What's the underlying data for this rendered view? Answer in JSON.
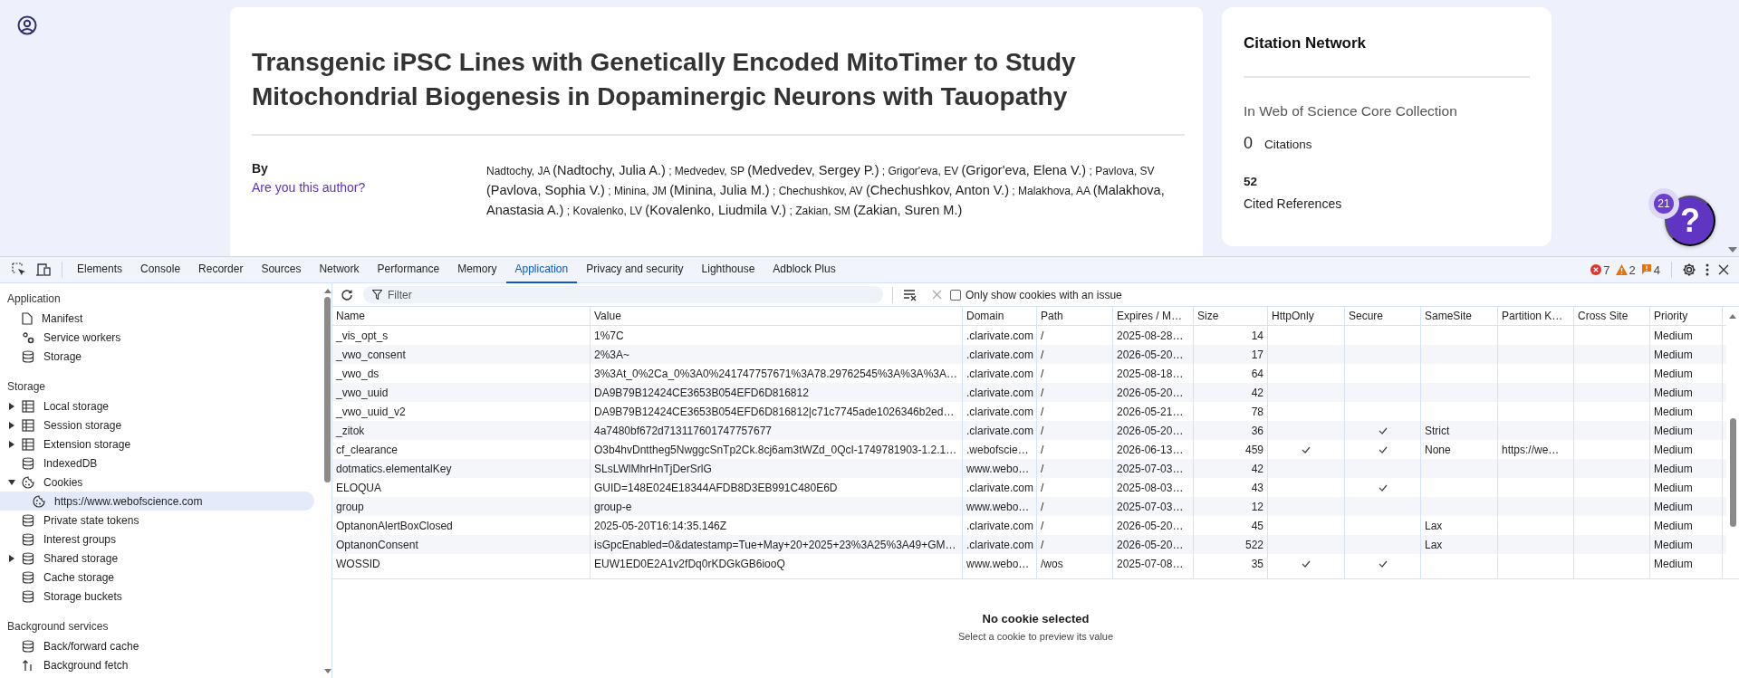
{
  "article": {
    "title": "Transgenic iPSC Lines with Genetically Encoded MitoTimer to Study Mitochondrial Biogenesis in Dopaminergic Neurons with Tauopathy",
    "by_label": "By",
    "author_link": "Are you this author?",
    "authors": [
      {
        "short": "Nadtochy, JA",
        "full": "(Nadtochy, Julia A.)",
        "sep": ";"
      },
      {
        "short": "Medvedev, SP",
        "full": "(Medvedev, Sergey P.)",
        "sep": ";"
      },
      {
        "short": "Grigor'eva, EV",
        "full": "(Grigor'eva, Elena V.)",
        "sep": ";"
      },
      {
        "short": "Pavlova, SV",
        "full": "(Pavlova, Sophia V.)",
        "sep": ";"
      },
      {
        "short": "Minina, JM",
        "full": "(Minina, Julia M.)",
        "sep": ";"
      },
      {
        "short": "Chechushkov, AV",
        "full": "(Chechushkov, Anton V.)",
        "sep": ";"
      },
      {
        "short": "Malakhova, AA",
        "full": "(Malakhova, Anastasia A.)",
        "sep": ";"
      },
      {
        "short": "Kovalenko, LV",
        "full": "(Kovalenko, Liudmila V.)",
        "sep": ";"
      },
      {
        "short": "Zakian, SM",
        "full": "(Zakian, Suren M.)"
      }
    ]
  },
  "citation": {
    "title": "Citation Network",
    "collection": "In Web of Science Core Collection",
    "citations_count": "0",
    "citations_label": "Citations",
    "references_count": "52",
    "references_label": "Cited References"
  },
  "help": {
    "badge": "21",
    "label": "?"
  },
  "devtools": {
    "tabs": [
      {
        "label": "Elements",
        "selected": false
      },
      {
        "label": "Console",
        "selected": false
      },
      {
        "label": "Recorder",
        "selected": false
      },
      {
        "label": "Sources",
        "selected": false
      },
      {
        "label": "Network",
        "selected": false
      },
      {
        "label": "Performance",
        "selected": false
      },
      {
        "label": "Memory",
        "selected": false
      },
      {
        "label": "Application",
        "selected": true
      },
      {
        "label": "Privacy and security",
        "selected": false
      },
      {
        "label": "Lighthouse",
        "selected": false
      },
      {
        "label": "Adblock Plus",
        "selected": false
      }
    ],
    "errors": "7",
    "warnings": "2",
    "issues": "4"
  },
  "sidebar": {
    "sections": [
      {
        "title": "Application",
        "items": [
          {
            "label": "Manifest",
            "kind": "file",
            "selected": false
          },
          {
            "label": "Service workers",
            "kind": "gears",
            "selected": false
          },
          {
            "label": "Storage",
            "kind": "database",
            "selected": false
          }
        ]
      },
      {
        "title": "Storage",
        "items": [
          {
            "label": "Local storage",
            "kind": "table",
            "expanded": false,
            "selected": false
          },
          {
            "label": "Session storage",
            "kind": "table",
            "expanded": false,
            "selected": false
          },
          {
            "label": "Extension storage",
            "kind": "table",
            "expanded": false,
            "selected": false
          },
          {
            "label": "IndexedDB",
            "kind": "database",
            "selected": false
          },
          {
            "label": "Cookies",
            "kind": "cookie",
            "expanded": true,
            "selected": false,
            "children": [
              {
                "label": "https://www.webofscience.com",
                "kind": "cookie",
                "selected": true
              }
            ]
          },
          {
            "label": "Private state tokens",
            "kind": "database",
            "selected": false
          },
          {
            "label": "Interest groups",
            "kind": "database",
            "selected": false
          },
          {
            "label": "Shared storage",
            "kind": "database",
            "expanded": false,
            "selected": false
          },
          {
            "label": "Cache storage",
            "kind": "database",
            "selected": false
          },
          {
            "label": "Storage buckets",
            "kind": "database",
            "selected": false
          }
        ]
      },
      {
        "title": "Background services",
        "items": [
          {
            "label": "Back/forward cache",
            "kind": "database",
            "selected": false
          },
          {
            "label": "Background fetch",
            "kind": "arrows",
            "selected": false
          }
        ]
      }
    ]
  },
  "cookies": {
    "filter": {
      "placeholder": "Filter"
    },
    "only_issues": {
      "label": "Only show cookies with an issue",
      "checked": false
    },
    "columns": [
      {
        "label": "Name"
      },
      {
        "label": "Value"
      },
      {
        "label": "Domain"
      },
      {
        "label": "Path"
      },
      {
        "label": "Expires / M…"
      },
      {
        "label": "Size"
      },
      {
        "label": "HttpOnly"
      },
      {
        "label": "Secure"
      },
      {
        "label": "SameSite"
      },
      {
        "label": "Partition K…"
      },
      {
        "label": "Cross Site"
      },
      {
        "label": "Priority"
      }
    ],
    "rows": [
      {
        "name": "_vis_opt_s",
        "value": "1%7C",
        "domain": ".clarivate.com",
        "path": "/",
        "expires": "2025-08-28…",
        "size": "14",
        "http_only": false,
        "secure": false,
        "priority": "Medium"
      },
      {
        "name": "_vwo_consent",
        "value": "2%3A~",
        "domain": ".clarivate.com",
        "path": "/",
        "expires": "2026-05-20…",
        "size": "17",
        "http_only": false,
        "secure": false,
        "priority": "Medium"
      },
      {
        "name": "_vwo_ds",
        "value": "3%3At_0%2Ca_0%3A0%241747757671%3A78.29762545%3A%3A%3A…",
        "domain": ".clarivate.com",
        "path": "/",
        "expires": "2025-08-18…",
        "size": "64",
        "http_only": false,
        "secure": false,
        "priority": "Medium"
      },
      {
        "name": "_vwo_uuid",
        "value": "DA9B79B12424CE3653B054EFD6D816812",
        "domain": ".clarivate.com",
        "path": "/",
        "expires": "2026-05-20…",
        "size": "42",
        "http_only": false,
        "secure": false,
        "priority": "Medium"
      },
      {
        "name": "_vwo_uuid_v2",
        "value": "DA9B79B12424CE3653B054EFD6D816812|c71c7745ade1026346b2ed…",
        "domain": ".clarivate.com",
        "path": "/",
        "expires": "2026-05-21…",
        "size": "78",
        "http_only": false,
        "secure": false,
        "priority": "Medium"
      },
      {
        "name": "_zitok",
        "value": "4a7480bf672d713117601747757677",
        "domain": ".clarivate.com",
        "path": "/",
        "expires": "2026-05-20…",
        "size": "36",
        "http_only": false,
        "secure": true,
        "same_site": "Strict",
        "priority": "Medium"
      },
      {
        "name": "cf_clearance",
        "value": "O3b4hvDnttheg5NwggcSnTp2Ck.8cj6am3tWZd_0QcI-1749781903-1.2.1…",
        "domain": ".webofscie…",
        "path": "/",
        "expires": "2026-06-13…",
        "size": "459",
        "http_only": true,
        "secure": true,
        "same_site": "None",
        "partition_key": "https://we…",
        "priority": "Medium"
      },
      {
        "name": "dotmatics.elementalKey",
        "value": "SLsLWlMhrHnTjDerSrlG",
        "domain": "www.webo…",
        "path": "/",
        "expires": "2025-07-03…",
        "size": "42",
        "http_only": false,
        "secure": false,
        "priority": "Medium"
      },
      {
        "name": "ELOQUA",
        "value": "GUID=148E024E18344AFDB8D3EB991C480E6D",
        "domain": ".clarivate.com",
        "path": "/",
        "expires": "2025-08-03…",
        "size": "43",
        "http_only": false,
        "secure": true,
        "priority": "Medium"
      },
      {
        "name": "group",
        "value": "group-e",
        "domain": "www.webo…",
        "path": "/",
        "expires": "2025-07-03…",
        "size": "12",
        "http_only": false,
        "secure": false,
        "priority": "Medium"
      },
      {
        "name": "OptanonAlertBoxClosed",
        "value": "2025-05-20T16:14:35.146Z",
        "domain": ".clarivate.com",
        "path": "/",
        "expires": "2026-05-20…",
        "size": "45",
        "http_only": false,
        "secure": false,
        "same_site": "Lax",
        "priority": "Medium"
      },
      {
        "name": "OptanonConsent",
        "value": "isGpcEnabled=0&datestamp=Tue+May+20+2025+23%3A25%3A49+GM…",
        "domain": ".clarivate.com",
        "path": "/",
        "expires": "2026-05-20…",
        "size": "522",
        "http_only": false,
        "secure": false,
        "same_site": "Lax",
        "priority": "Medium"
      },
      {
        "name": "WOSSID",
        "value": "EUW1ED0E2A1v2fDq0rKDGkGB6iooQ",
        "domain": "www.webo…",
        "path": "/wos",
        "expires": "2025-07-08…",
        "size": "35",
        "http_only": true,
        "secure": true,
        "priority": "Medium"
      }
    ]
  },
  "preview": {
    "title": "No cookie selected",
    "hint": "Select a cookie to preview its value"
  }
}
